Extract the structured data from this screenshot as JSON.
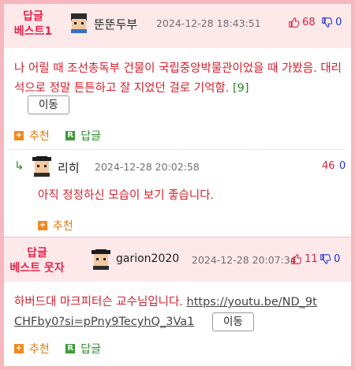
{
  "comments": [
    {
      "badge_line1": "답글",
      "badge_line2": "베스트1",
      "author": "뚠뚠두부",
      "timestamp": "2024-12-28 18:43:51",
      "upvotes": "68",
      "downvotes": "0",
      "text": "나 어릴 때 조선총독부 건물이 국립중앙박물관이었을 때 가봤음. 대리석으로 정말 튼튼하고 잘 지었던 걸로 기억함.",
      "reply_count": "[9]",
      "move_label": "이동",
      "recommend_label": "추천",
      "reply_label": "답글",
      "reply_icon_letter": "R"
    },
    {
      "reply_arrow": "↳",
      "author": "리히",
      "timestamp": "2024-12-28 20:02:58",
      "upvotes": "46",
      "downvotes": "0",
      "text": "아직 정정하신 모습이 보기 좋습니다.",
      "recommend_label": "추천"
    },
    {
      "badge_line1": "답글",
      "badge_line2": "베스트 웃자",
      "author": "garion2020",
      "timestamp": "2024-12-28 20:07:34",
      "upvotes": "11",
      "downvotes": "0",
      "text": "하버드대 마크피터슨 교수님입니다. ",
      "link_line1": "https://youtu.be/ND_9t",
      "link_line2": "CHFby0?si=pPny9TecyhQ_3Va1",
      "move_label": "이동",
      "recommend_label": "추천",
      "reply_label": "답글",
      "reply_icon_letter": "R"
    }
  ],
  "colors": {
    "frame_border": "#f7b7bf",
    "best_background": "#fde8ea",
    "best_label": "#e4264d",
    "comment_text": "#d61e2b",
    "upvote": "#d1243b",
    "downvote": "#1d35c9",
    "recommend": "#e07b0b",
    "reply": "#2e8b2e"
  },
  "icons": {
    "upvote": "thumbs-up-icon",
    "downvote": "thumbs-down-icon",
    "recommend": "plus-square-icon",
    "reply": "reply-square-icon"
  }
}
